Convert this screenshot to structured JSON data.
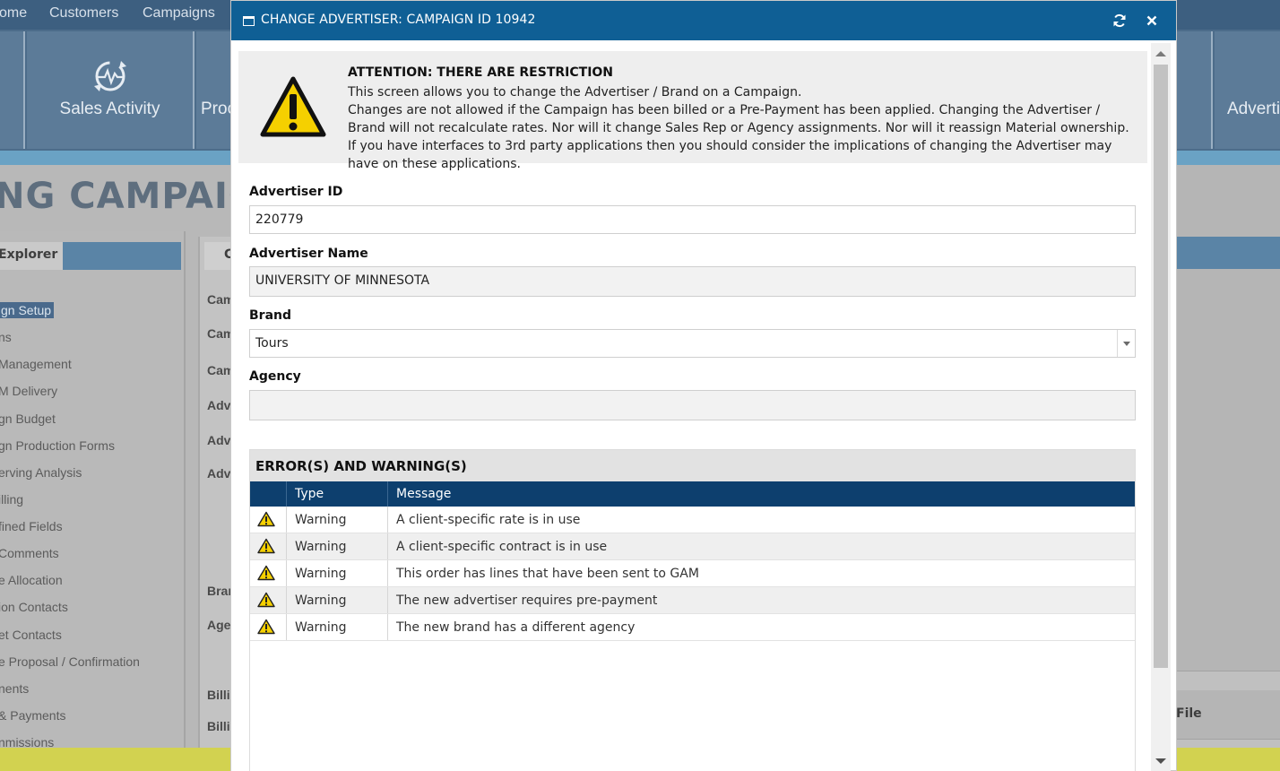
{
  "background": {
    "nav": [
      "ome",
      "Customers",
      "Campaigns"
    ],
    "tiles": [
      {
        "label": "Sales Activity",
        "icon": "heartbeat-refresh-icon"
      },
      {
        "label": "Proc"
      },
      {
        "label": "Adverti"
      }
    ],
    "heading": "NG CAMPAIGN",
    "explorer": {
      "tab": "Explorer",
      "items": [
        "gn Setup",
        "ns",
        " Management",
        "M Delivery",
        "gn Budget",
        "gn Production Forms",
        "erving Analysis",
        "illing",
        "fined Fields",
        "Comments",
        "e Allocation",
        "ion Contacts",
        "et Contacts",
        "e Proposal / Confirmation",
        "nents",
        " & Payments",
        "nmissions"
      ]
    },
    "center": {
      "tab": "C",
      "labels": [
        "Cam",
        "Cam",
        "Cam",
        "Adv",
        "Adv",
        "Adv",
        "Bran",
        "Age",
        "Billi",
        "Billi"
      ]
    },
    "right": {
      "file_label": "File"
    }
  },
  "modal": {
    "title": "CHANGE ADVERTISER: CAMPAIGN ID 10942",
    "notice": {
      "icon": "warning-triangle-icon",
      "title": "ATTENTION: THERE ARE RESTRICTION",
      "line1": "This screen allows you to change the Advertiser / Brand on a Campaign.",
      "line2": "Changes are not allowed if the Campaign has been billed or a Pre-Payment has been applied. Changing the Advertiser / Brand will not recalculate rates. Nor will it change Sales Rep or Agency assignments. Nor will it reassign Material ownership. If you have interfaces to 3rd party applications then you should consider the implications of changing the Advertiser may have on these applications."
    },
    "fields": {
      "advertiser_id": {
        "label": "Advertiser ID",
        "value": "220779"
      },
      "advertiser_name": {
        "label": "Advertiser Name",
        "value": "UNIVERSITY OF MINNESOTA"
      },
      "brand": {
        "label": "Brand",
        "value": "Tours"
      },
      "agency": {
        "label": "Agency",
        "value": ""
      }
    },
    "errors": {
      "title": "ERROR(S) AND WARNING(S)",
      "columns": [
        "",
        "Type",
        "Message"
      ],
      "rows": [
        {
          "type": "Warning",
          "message": "A client-specific rate is in use"
        },
        {
          "type": "Warning",
          "message": "A client-specific contract is in use"
        },
        {
          "type": "Warning",
          "message": "This order has lines that have been sent to GAM"
        },
        {
          "type": "Warning",
          "message": "The new advertiser requires pre-payment"
        },
        {
          "type": "Warning",
          "message": "The new brand has a different agency"
        }
      ]
    }
  },
  "colors": {
    "header": "#0f5f95",
    "grid_header": "#0d3f6e",
    "warning": "#f5d000"
  }
}
